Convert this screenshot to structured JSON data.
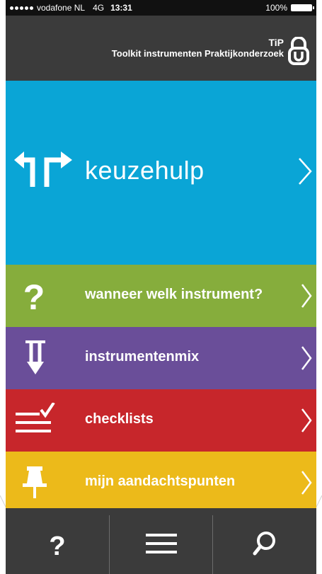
{
  "status_bar": {
    "carrier": "vodafone NL",
    "network": "4G",
    "time": "13:31",
    "battery_percent": "100%",
    "battery_level": 1.0
  },
  "header": {
    "app_short_name": "TiP",
    "app_full_name": "Toolkit instrumenten Praktijkonderzoek",
    "logo_icon": "padlock-u-icon"
  },
  "menu": {
    "items": [
      {
        "label": "keuzehulp",
        "icon": "fork-arrows-icon",
        "color": "#0aa5d6"
      },
      {
        "label": "wanneer welk instrument?",
        "icon": "question-mark-icon",
        "color": "#86ad3c"
      },
      {
        "label": "instrumentenmix",
        "icon": "merge-arrows-down-icon",
        "color": "#6a4e99"
      },
      {
        "label": "checklists",
        "icon": "checklist-icon",
        "color": "#c7262b"
      },
      {
        "label": "mijn aandachtspunten",
        "icon": "pushpin-icon",
        "color": "#ecba1a"
      }
    ]
  },
  "tab_bar": {
    "tabs": [
      {
        "icon": "help-icon"
      },
      {
        "icon": "hamburger-menu-icon"
      },
      {
        "icon": "search-icon"
      }
    ]
  }
}
